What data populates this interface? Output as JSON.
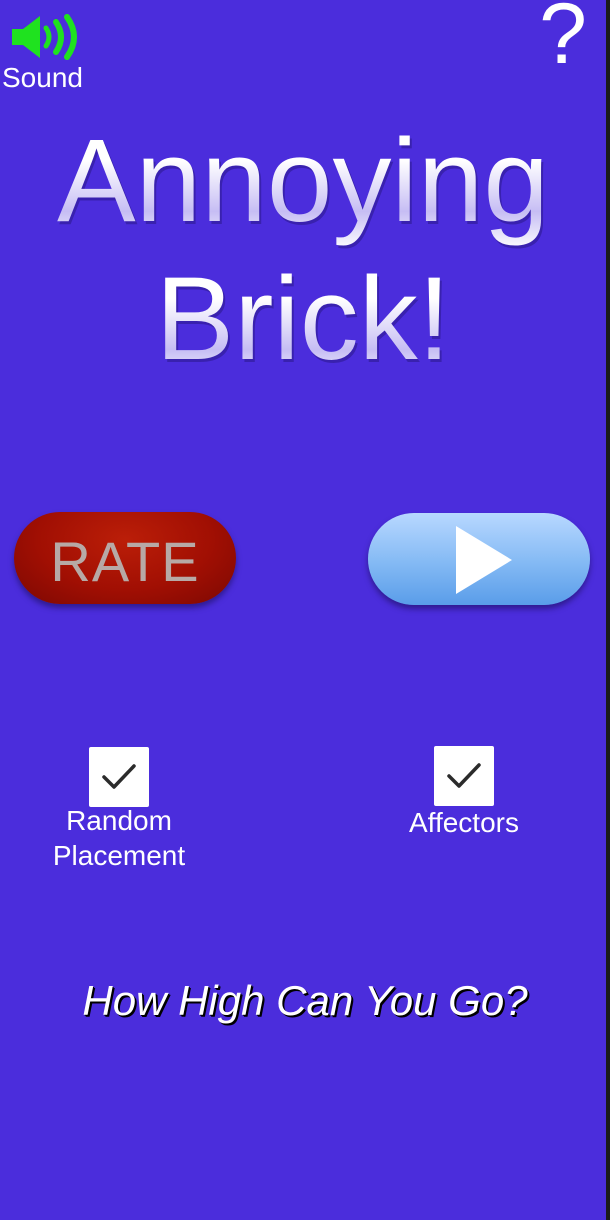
{
  "sound": {
    "icon": "speaker-volume-icon",
    "label": "Sound",
    "icon_color": "#1fe21f"
  },
  "help": {
    "label": "?"
  },
  "title": {
    "line1": "Annoying",
    "line2": "Brick!"
  },
  "buttons": {
    "rate_label": "RATE",
    "play_icon": "play-icon"
  },
  "options": [
    {
      "label_line1": "Random",
      "label_line2": "Placement",
      "checked": true
    },
    {
      "label_line1": "Affectors",
      "label_line2": "",
      "checked": true
    }
  ],
  "tagline": "How High Can You Go?",
  "colors": {
    "background": "#4b2ddc",
    "rate_button": "#a10f03",
    "play_button": "#88bcf5",
    "sound_icon": "#1fe21f"
  }
}
